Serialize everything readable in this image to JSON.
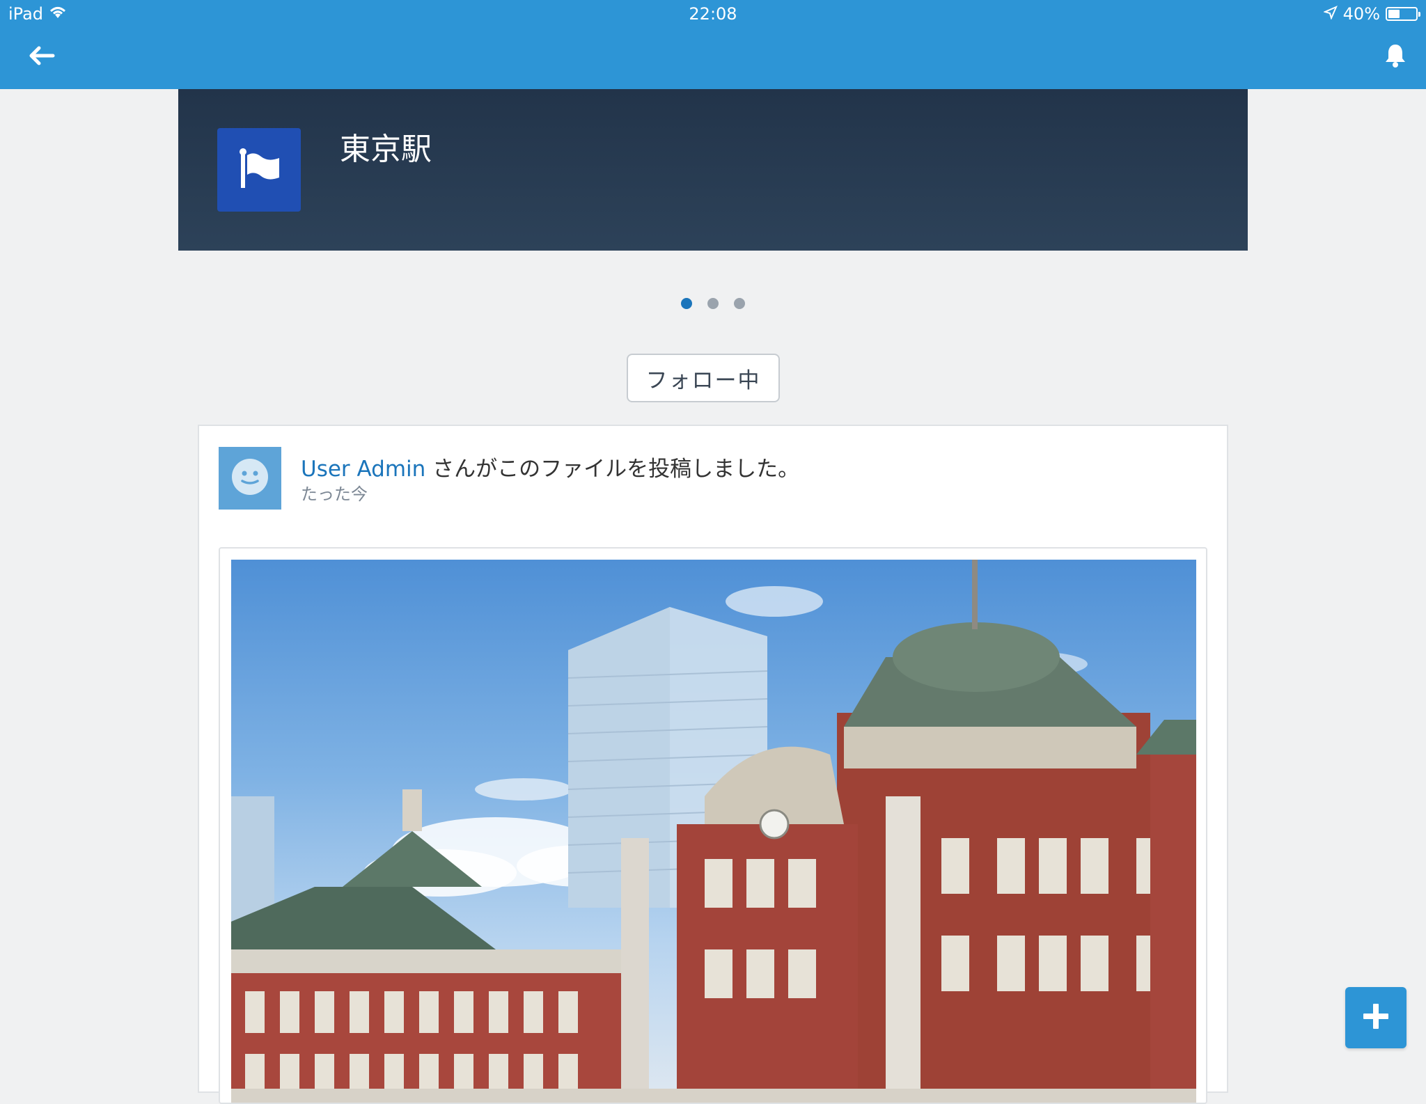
{
  "status_bar": {
    "carrier": "iPad",
    "time": "22:08",
    "battery": "40%",
    "battery_level": 0.4
  },
  "nav": {
    "back_icon": "arrow-left-icon",
    "notifications_icon": "bell-icon"
  },
  "header": {
    "title": "東京駅",
    "icon": "flag-icon",
    "icon_color": "#204fb3"
  },
  "carousel": {
    "page_count": 3,
    "active_index": 0
  },
  "follow_button": {
    "label": "フォロー中"
  },
  "feed_item": {
    "user": "User Admin",
    "action": " さんがこのファイルを投稿しました。",
    "timestamp": "たった今",
    "attachment_icon": "photo-of-tokyo-station"
  },
  "fab": {
    "icon": "plus-icon"
  },
  "colors": {
    "accent": "#2d95d6",
    "header_bg": "#22344a",
    "link": "#1b75bb"
  }
}
